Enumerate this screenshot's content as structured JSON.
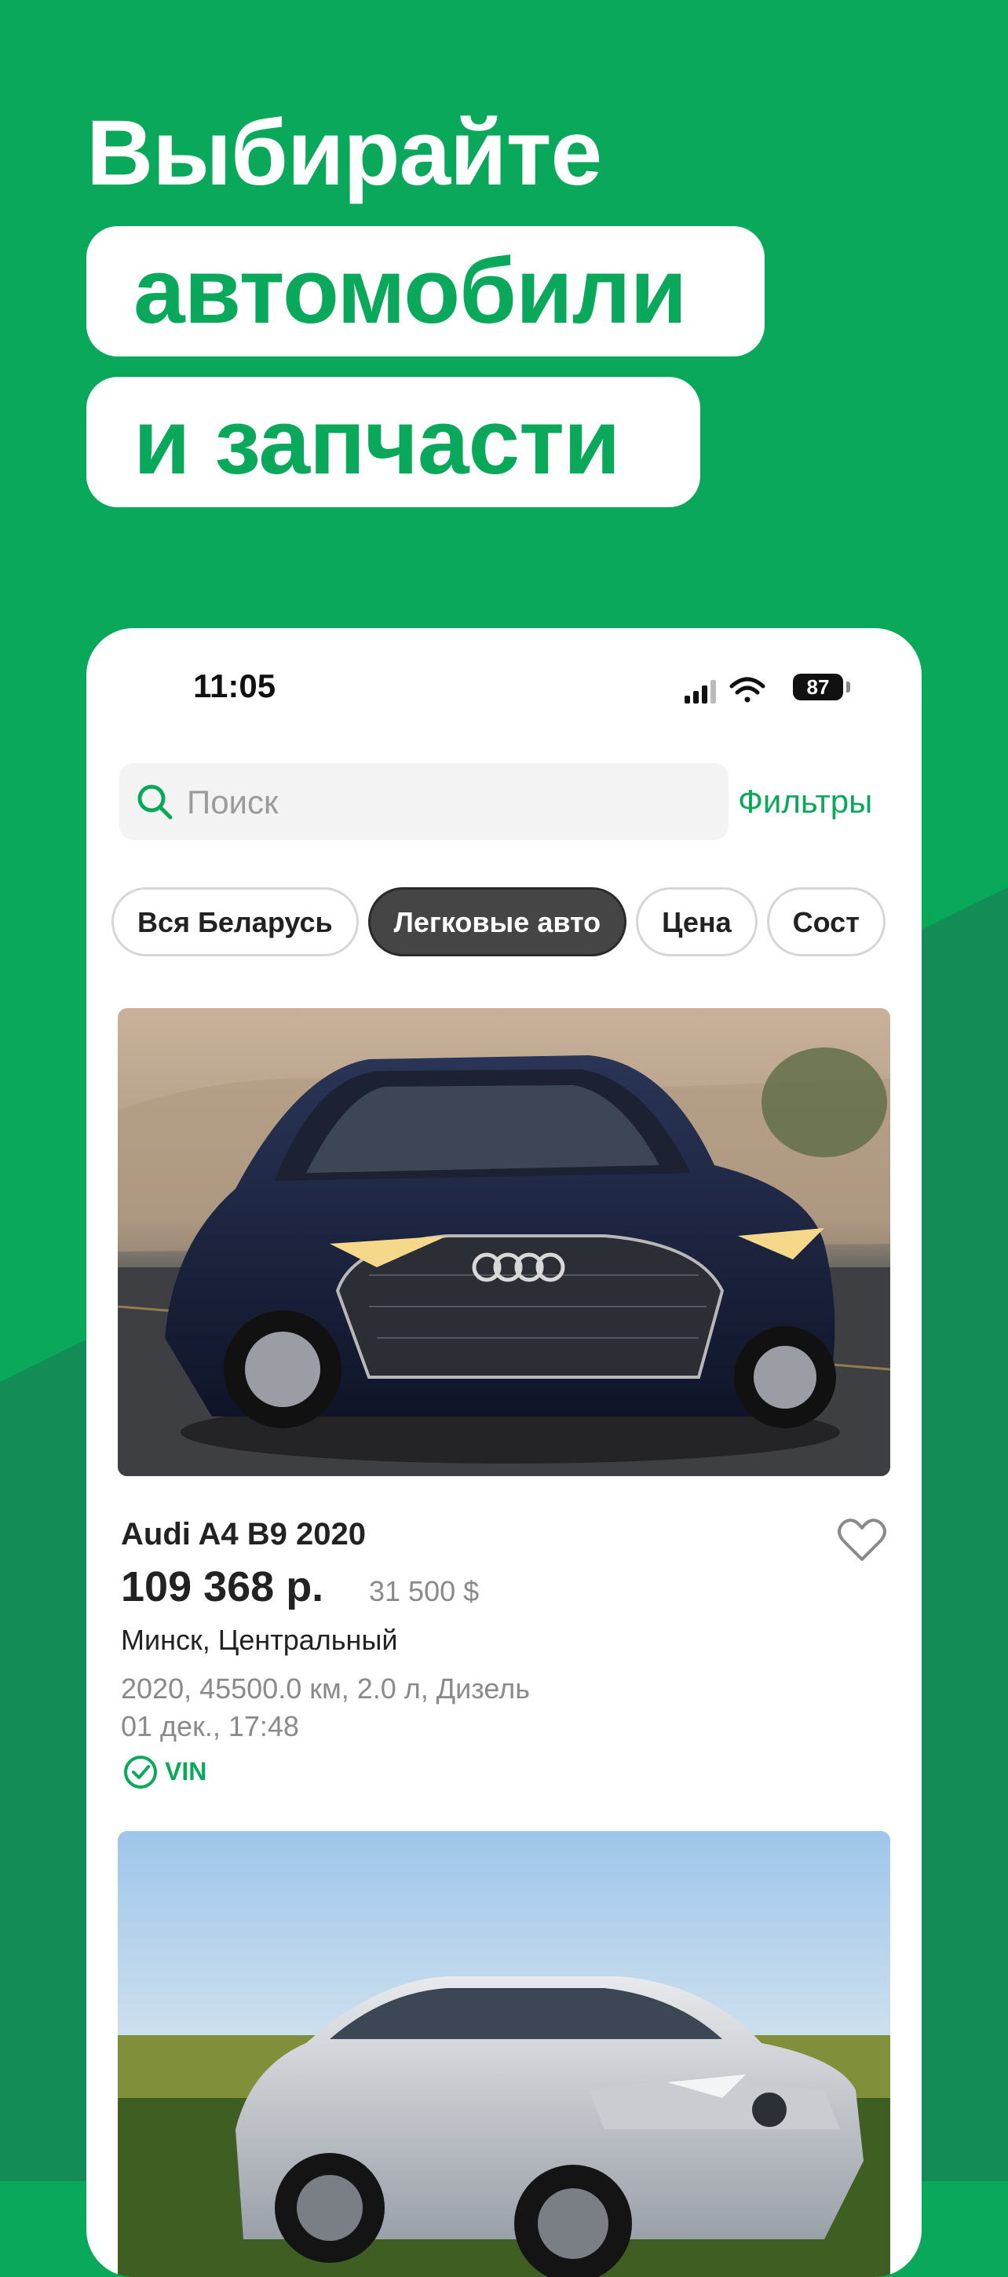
{
  "promo": {
    "line1": "Выбирайте",
    "line2": "автомобили",
    "line3": "и запчасти"
  },
  "status_bar": {
    "time": "11:05",
    "battery": "87"
  },
  "search": {
    "placeholder": "Поиск",
    "filters_label": "Фильтры"
  },
  "chips": [
    {
      "label": "Вся Беларусь",
      "active": false
    },
    {
      "label": "Легковые авто",
      "active": true
    },
    {
      "label": "Цена",
      "active": false
    },
    {
      "label": "Сост",
      "active": false
    }
  ],
  "listings": [
    {
      "title": "Audi A4 B9 2020",
      "price": "109 368 р.",
      "price_usd": "31 500 $",
      "location": "Минск, Центральный",
      "specs": "2020, 45500.0 км, 2.0 л, Дизель",
      "date": "01 дек., 17:48",
      "badge": "VIN"
    }
  ],
  "colors": {
    "brand_green": "#0aa85a",
    "dark_green": "#138c55",
    "active_chip": "#454545"
  },
  "icons": {
    "search": "search-icon",
    "favorite": "heart-icon",
    "verified": "check-circle-icon"
  }
}
